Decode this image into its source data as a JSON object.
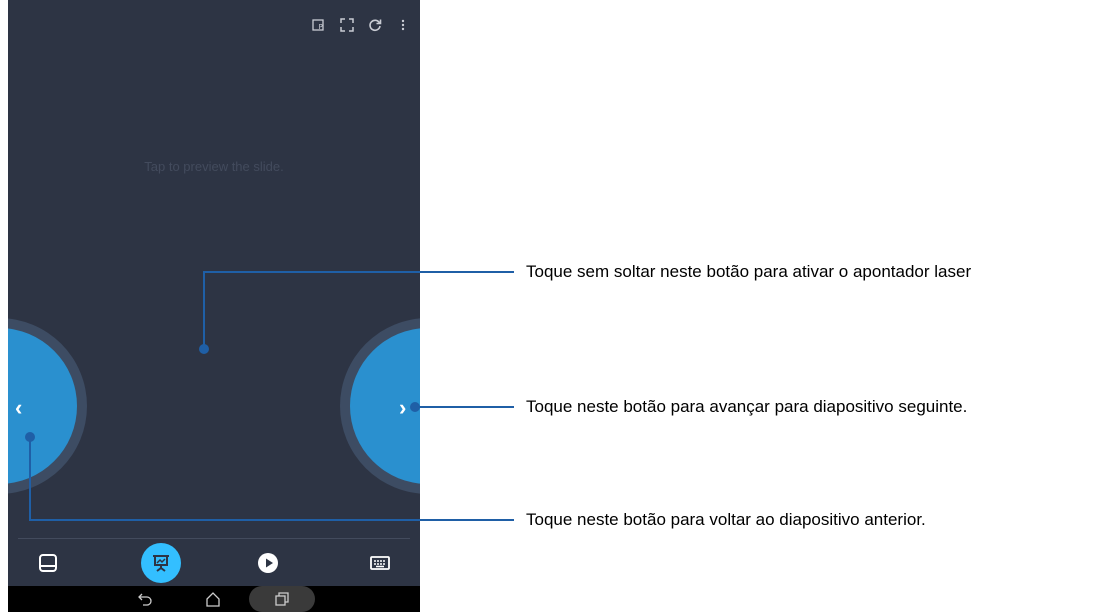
{
  "topbar": {
    "icons": [
      "presentation-select-icon",
      "fullscreen-icon",
      "refresh-icon",
      "more-vert-icon"
    ]
  },
  "main": {
    "hint": "Tap to preview the slide."
  },
  "buttons": {
    "prev_chevron": "‹",
    "next_chevron": "›"
  },
  "toolbar": {
    "items": [
      "touchpad-icon",
      "presentation-icon",
      "play-icon",
      "keyboard-icon"
    ],
    "active": "presentation-icon"
  },
  "navbar": {
    "items": [
      "back-icon",
      "home-icon",
      "recents-icon"
    ]
  },
  "callouts": {
    "laser": "Toque sem soltar neste botão para ativar o apontador laser",
    "next": "Toque neste botão para avançar para diapositivo seguinte.",
    "prev": "Toque neste botão para voltar ao diapositivo anterior."
  },
  "colors": {
    "background": "#2d3444",
    "accent": "#2a90cf",
    "active": "#33bfff",
    "leader": "#1f5fa6"
  }
}
